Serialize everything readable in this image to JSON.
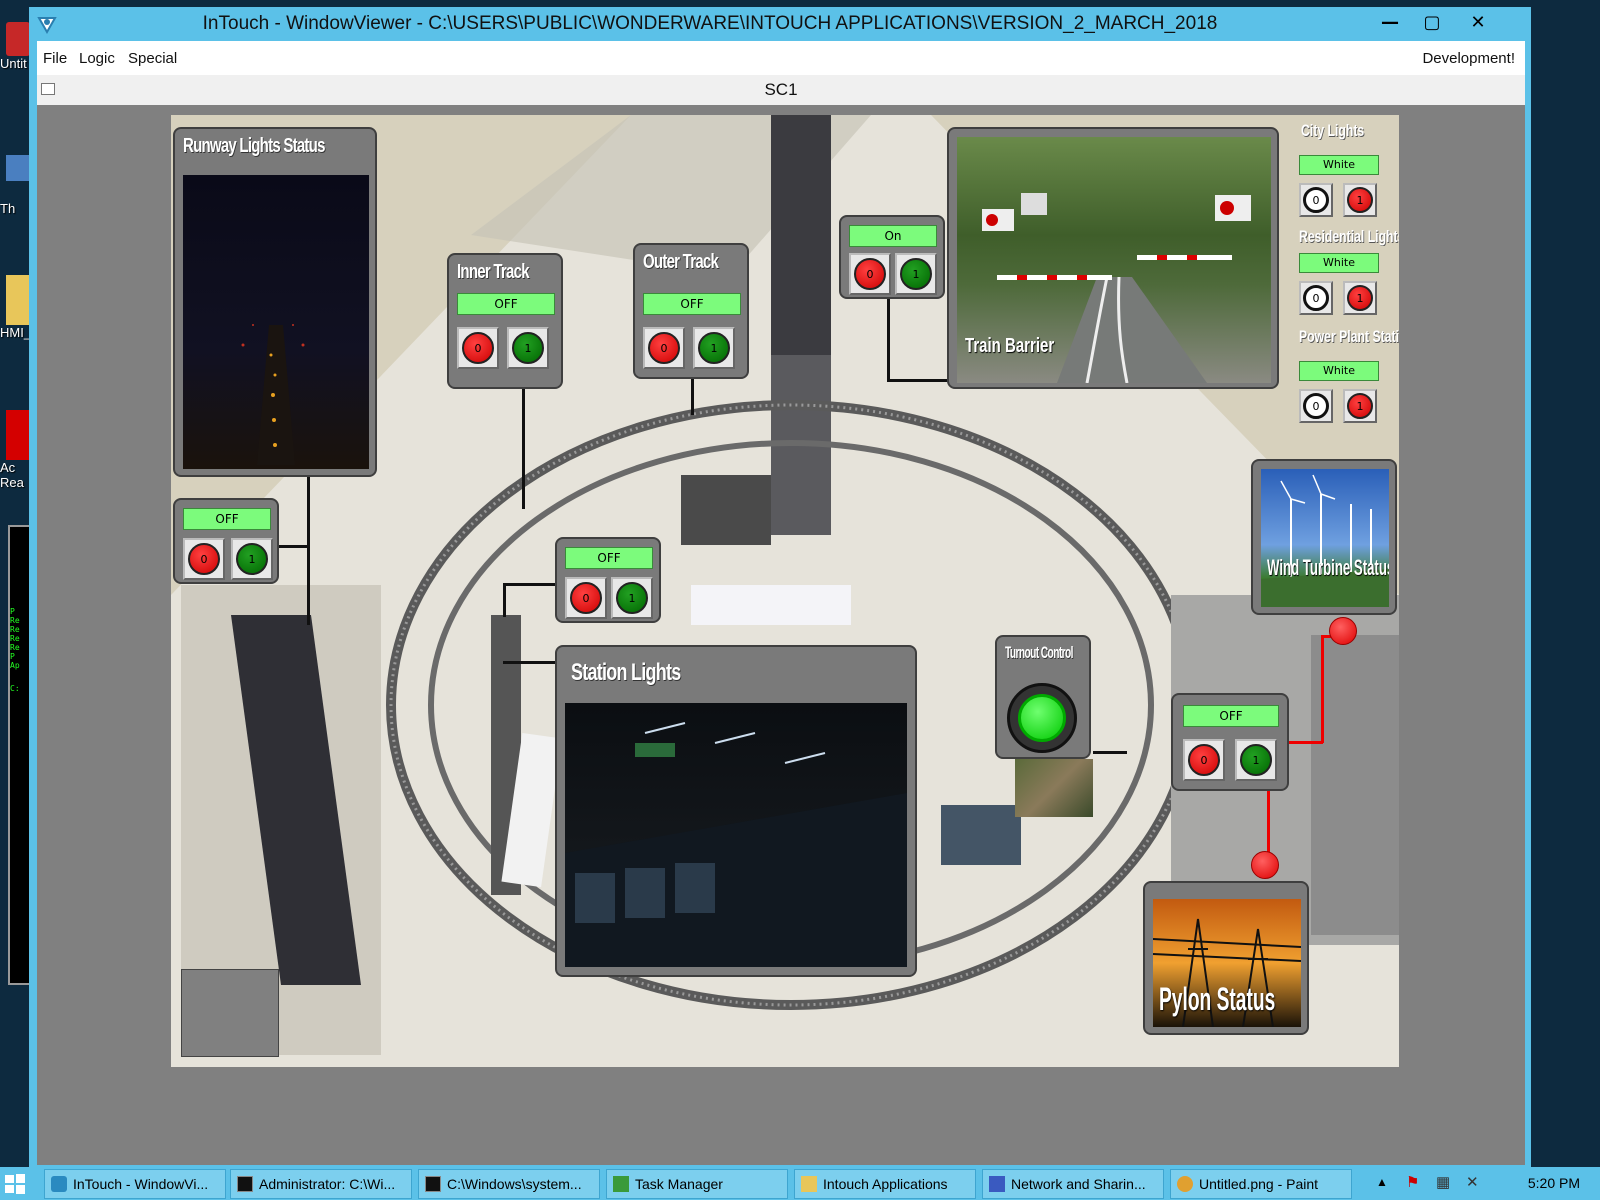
{
  "desktop": {
    "icons": [
      {
        "label": "Untit",
        "icon": "paint-file-icon"
      },
      {
        "label": "Th",
        "icon": "computer-icon"
      },
      {
        "label": "HMI_",
        "icon": "folder-icon"
      },
      {
        "label": "Ac Rea",
        "icon": "acrobat-reader-icon"
      }
    ],
    "console_lines": [
      "P",
      "Re",
      "Re",
      "Re",
      "Re",
      "P",
      "Ap",
      "C:"
    ]
  },
  "window": {
    "title": "InTouch - WindowViewer - C:\\USERS\\PUBLIC\\WONDERWARE\\INTOUCH APPLICATIONS\\VERSION_2_MARCH_2018",
    "buttons": {
      "minimize": "—",
      "maximize": "▢",
      "close": "✕"
    }
  },
  "menu": {
    "items": [
      "File",
      "Logic",
      "Special"
    ],
    "right_label": "Development!"
  },
  "document": {
    "title": "SC1"
  },
  "hmi": {
    "runway": {
      "title": "Runway Lights Status",
      "status": "OFF",
      "btn0": "0",
      "btn1": "1"
    },
    "inner_track": {
      "title": "Inner Track",
      "status": "OFF",
      "btn0": "0",
      "btn1": "1"
    },
    "outer_track": {
      "title": "Outer Track",
      "status": "OFF",
      "btn0": "0",
      "btn1": "1"
    },
    "barrier_control": {
      "status": "On",
      "btn0": "0",
      "btn1": "1"
    },
    "train_barrier": {
      "label": "Train Barrier"
    },
    "city_lights": {
      "title": "City Lights",
      "status": "White",
      "btn0": "0",
      "btn1": "1"
    },
    "residential_lights": {
      "title": "Residential Lights",
      "status": "White",
      "btn0": "0",
      "btn1": "1"
    },
    "power_plant": {
      "title": "Power Plant Station",
      "status": "White",
      "btn0": "0",
      "btn1": "1"
    },
    "wind_turbine": {
      "label": "Wind Turbine Status"
    },
    "station_control": {
      "status": "OFF",
      "btn0": "0",
      "btn1": "1"
    },
    "station_lights": {
      "title": "Station Lights"
    },
    "turnout": {
      "title": "Turnout Control"
    },
    "pylon_control": {
      "status": "OFF",
      "btn0": "0",
      "btn1": "1"
    },
    "pylon": {
      "label": "Pylon Status"
    }
  },
  "taskbar": {
    "tasks": [
      {
        "label": "InTouch - WindowVi...",
        "icon": "intouch-icon"
      },
      {
        "label": "Administrator: C:\\Wi...",
        "icon": "cmd-icon"
      },
      {
        "label": "C:\\Windows\\system...",
        "icon": "cmd-icon"
      },
      {
        "label": "Task Manager",
        "icon": "task-manager-icon"
      },
      {
        "label": "Intouch Applications",
        "icon": "folder-icon"
      },
      {
        "label": "Network and Sharin...",
        "icon": "network-icon"
      },
      {
        "label": "Untitled.png - Paint",
        "icon": "paint-icon"
      }
    ],
    "clock": "5:20 PM"
  }
}
